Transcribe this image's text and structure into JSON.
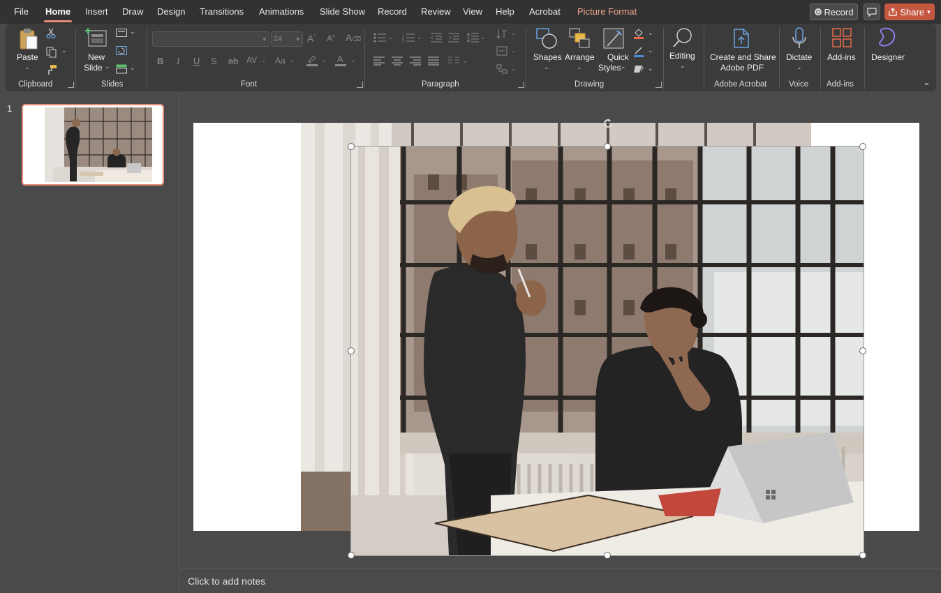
{
  "menu": {
    "items": [
      "File",
      "Home",
      "Insert",
      "Draw",
      "Design",
      "Transitions",
      "Animations",
      "Slide Show",
      "Record",
      "Review",
      "View",
      "Help",
      "Acrobat",
      "Picture Format"
    ],
    "record_label": "Record",
    "share_label": "Share"
  },
  "ribbon": {
    "clipboard": {
      "paste": "Paste",
      "group": "Clipboard"
    },
    "slides": {
      "new_slide": "New Slide",
      "new_slide_line1": "New",
      "new_slide_line2": "Slide",
      "group": "Slides"
    },
    "font": {
      "font_name": "",
      "font_size": "24",
      "group": "Font",
      "bold": "B",
      "italic": "I",
      "underline": "U",
      "shadow": "S",
      "strike": "ab",
      "spacing": "AV",
      "case": "Aa"
    },
    "paragraph": {
      "group": "Paragraph"
    },
    "drawing": {
      "shapes": "Shapes",
      "arrange": "Arrange",
      "quick_styles_line1": "Quick",
      "quick_styles_line2": "Styles",
      "group": "Drawing"
    },
    "editing": {
      "label": "Editing"
    },
    "acrobat": {
      "line1": "Create and Share",
      "line2": "Adobe PDF",
      "group": "Adobe Acrobat"
    },
    "voice": {
      "dictate": "Dictate",
      "group": "Voice"
    },
    "addins": {
      "label": "Add-ins",
      "group": "Add-ins"
    },
    "designer": {
      "label": "Designer"
    }
  },
  "thumbnails": {
    "slide_number": "1"
  },
  "notes": {
    "placeholder": "Click to add notes"
  },
  "colors": {
    "accent": "#e68b7a",
    "share": "#c4573f",
    "picture_format": "#f1a48e"
  }
}
